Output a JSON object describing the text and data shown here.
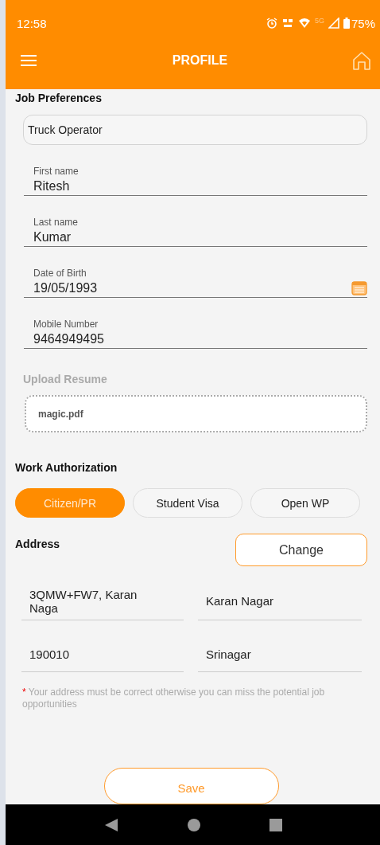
{
  "status_bar": {
    "time": "12:58",
    "network": "5G",
    "battery": "75%"
  },
  "app_bar": {
    "title": "PROFILE"
  },
  "job_preferences": {
    "label": "Job Preferences",
    "value": "Truck Operator"
  },
  "fields": [
    {
      "label": "First name",
      "value": "Ritesh",
      "kind": "text"
    },
    {
      "label": "Last name",
      "value": "Kumar",
      "kind": "text"
    },
    {
      "label": "Date of Birth",
      "value": "19/05/1993",
      "kind": "date"
    },
    {
      "label": "Mobile Number",
      "value": "9464949495",
      "kind": "text"
    }
  ],
  "upload_resume": {
    "label": "Upload Resume",
    "file": "magic.pdf"
  },
  "work_authorization": {
    "label": "Work Authorization",
    "options": [
      {
        "label": "Citizen/PR",
        "selected": true
      },
      {
        "label": "Student Visa",
        "selected": false
      },
      {
        "label": "Open WP",
        "selected": false
      }
    ]
  },
  "address": {
    "label": "Address",
    "change_button": "Change",
    "fields": [
      {
        "value": "3QMW+FW7, Karan Naga"
      },
      {
        "value": "Karan Nagar"
      },
      {
        "value": "190010"
      },
      {
        "value": "Srinagar"
      }
    ],
    "note_mark": "*",
    "note": "Your address must be correct otherwise you can miss the potential job opportunities"
  },
  "save_button": "Save"
}
